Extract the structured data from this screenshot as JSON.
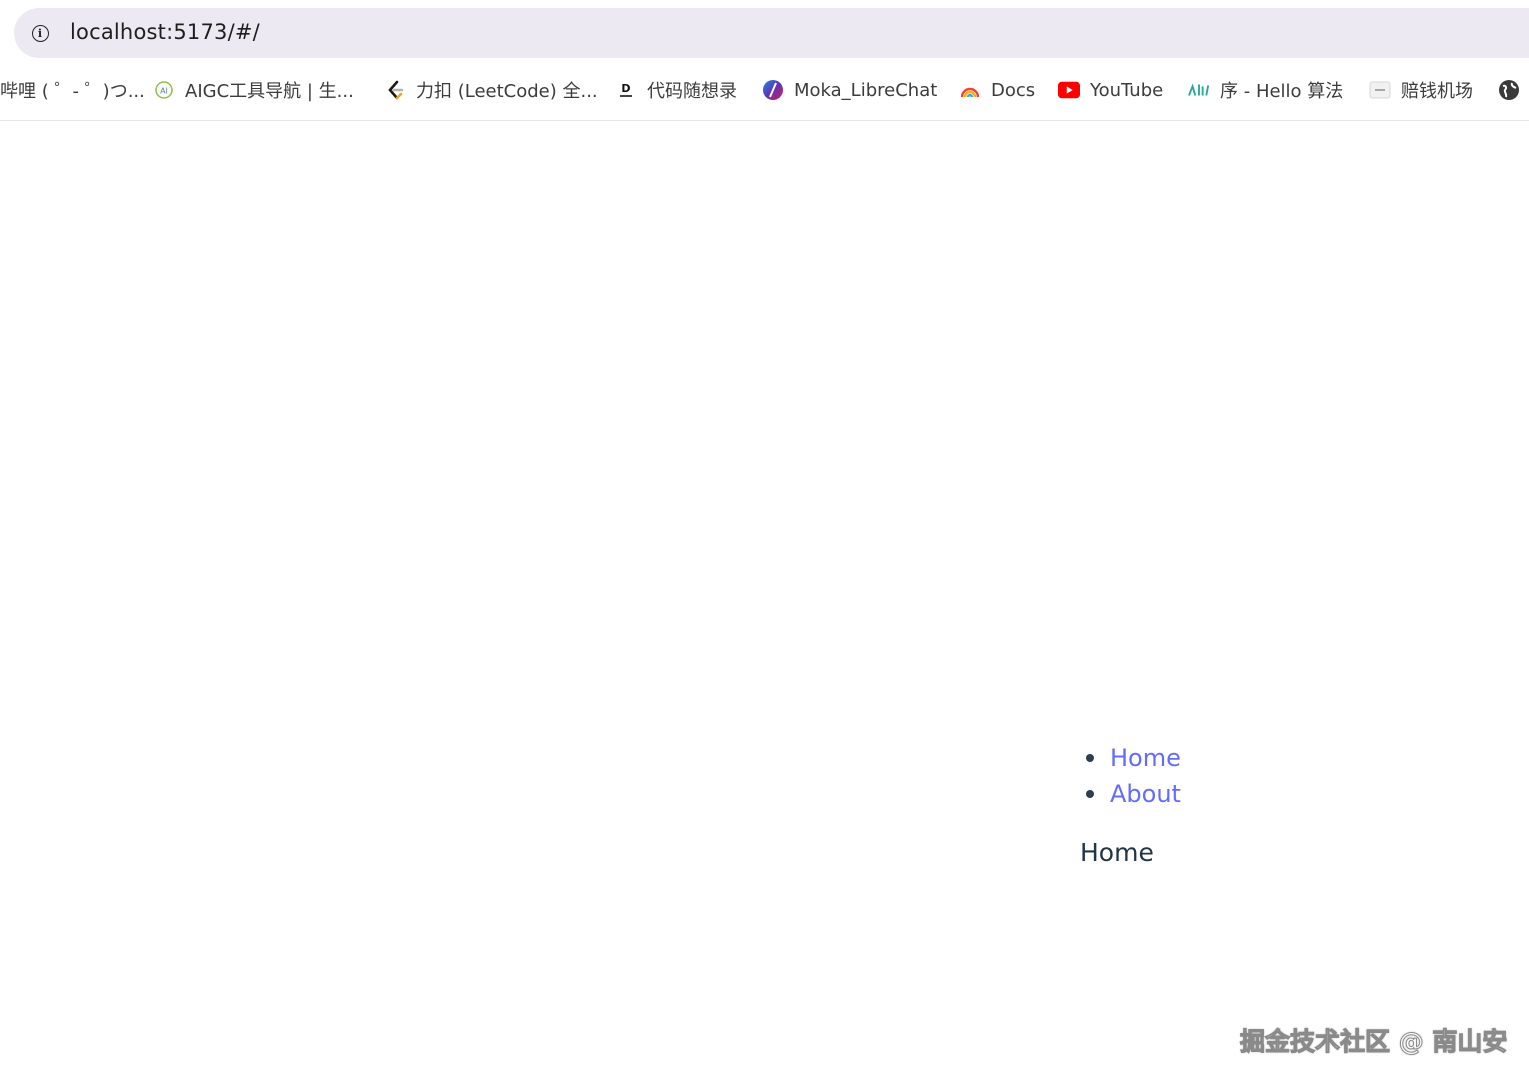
{
  "browser": {
    "url": "localhost:5173/#/",
    "bookmarks": [
      {
        "label": "哔哩哔哩 (゜-゜)つ...",
        "visible_label": "哔哩 ( ゜- ゜)つ...",
        "icon": "bilibili-icon"
      },
      {
        "label": "AIGC工具导航 | 生...",
        "icon": "aigc-icon"
      },
      {
        "label": "力扣 (LeetCode) 全...",
        "icon": "leetcode-icon"
      },
      {
        "label": "代码随想录",
        "icon": "daimasuixiang-icon"
      },
      {
        "label": "Moka_LibreChat",
        "icon": "librechat-icon"
      },
      {
        "label": "Docs",
        "icon": "rainbow-icon"
      },
      {
        "label": "YouTube",
        "icon": "youtube-icon"
      },
      {
        "label": "序 - Hello 算法",
        "icon": "hello-algo-icon"
      },
      {
        "label": "赔钱机场",
        "icon": "airport-icon"
      },
      {
        "label": "",
        "icon": "globe-icon"
      }
    ]
  },
  "page": {
    "nav": [
      {
        "label": "Home"
      },
      {
        "label": "About"
      }
    ],
    "view_title": "Home"
  },
  "watermark": "掘金技术社区 @ 南山安",
  "colors": {
    "link": "#646cff",
    "text": "#213547",
    "omnibox_bg": "#ece9f2"
  }
}
